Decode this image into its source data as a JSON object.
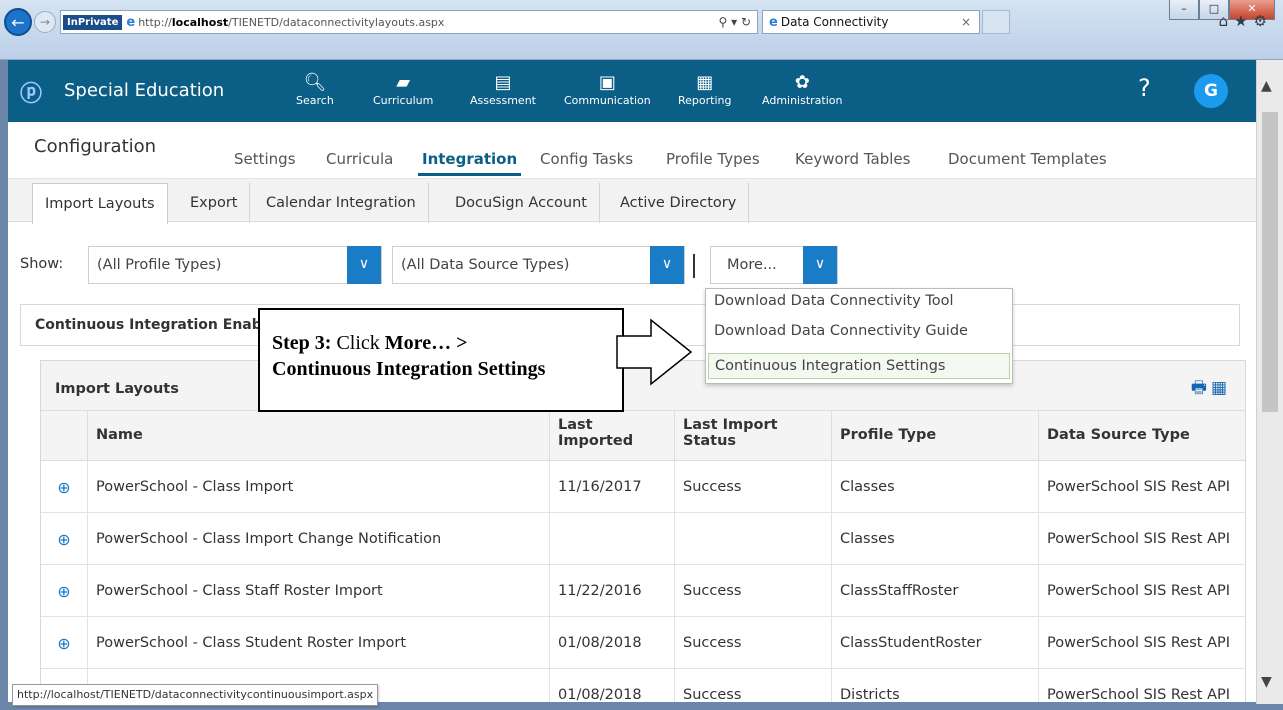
{
  "browser": {
    "inprivate": "InPrivate",
    "url_prefix": "http://",
    "url_host": "localhost",
    "url_path": "/TIENETD/dataconnectivitylayouts.aspx",
    "address_tools": "⚲ ▾ ↻",
    "tab_title": "Data Connectivity",
    "status_url": "http://localhost/TIENETD/dataconnectivitycontinuousimport.aspx"
  },
  "app": {
    "brand": "Special Education",
    "nav": [
      {
        "label": "Search",
        "icon": "search-icon"
      },
      {
        "label": "Curriculum",
        "icon": "book-icon"
      },
      {
        "label": "Assessment",
        "icon": "clipboard-icon"
      },
      {
        "label": "Communication",
        "icon": "communication-icon"
      },
      {
        "label": "Reporting",
        "icon": "report-icon"
      },
      {
        "label": "Administration",
        "icon": "gear-icon"
      }
    ],
    "help": "?",
    "avatar": "G"
  },
  "config": {
    "title": "Configuration",
    "subnav": [
      "Settings",
      "Curricula",
      "Integration",
      "Config Tasks",
      "Profile Types",
      "Keyword Tables",
      "Document Templates"
    ],
    "active_subnav": "Integration",
    "tabs": [
      "Import Layouts",
      "Export",
      "Calendar Integration",
      "DocuSign Account",
      "Active Directory"
    ],
    "active_tab": "Import Layouts"
  },
  "filters": {
    "show_label": "Show:",
    "profile_types": "(All Profile Types)",
    "data_source_types": "(All Data Source Types)",
    "more": "More..."
  },
  "more_menu": [
    "Download Data Connectivity Tool",
    "Download Data Connectivity Guide",
    "Continuous Integration Settings"
  ],
  "ci_panel": "Continuous Integration Enab",
  "callout": {
    "step": "Step 3:",
    "text1": " Click ",
    "more": "More… >",
    "line2": "Continuous Integration Settings"
  },
  "grid": {
    "title": "Import Layouts",
    "columns": [
      "Name",
      "Last Imported",
      "Last Import Status",
      "Profile Type",
      "Data Source Type"
    ],
    "rows": [
      {
        "name": "PowerSchool - Class Import",
        "last_imported": "11/16/2017",
        "status": "Success",
        "profile": "Classes",
        "source": "PowerSchool SIS Rest API"
      },
      {
        "name": "PowerSchool - Class Import Change Notification",
        "last_imported": "",
        "status": "",
        "profile": "Classes",
        "source": "PowerSchool SIS Rest API"
      },
      {
        "name": "PowerSchool - Class Staff Roster Import",
        "last_imported": "11/22/2016",
        "status": "Success",
        "profile": "ClassStaffRoster",
        "source": "PowerSchool SIS Rest API"
      },
      {
        "name": "PowerSchool - Class Student Roster Import",
        "last_imported": "01/08/2018",
        "status": "Success",
        "profile": "ClassStudentRoster",
        "source": "PowerSchool SIS Rest API"
      },
      {
        "name": "",
        "last_imported": "01/08/2018",
        "status": "Success",
        "profile": "Districts",
        "source": "PowerSchool SIS Rest API"
      }
    ]
  },
  "colors": {
    "brand": "#0b5e86",
    "accent": "#1a7bc7"
  }
}
